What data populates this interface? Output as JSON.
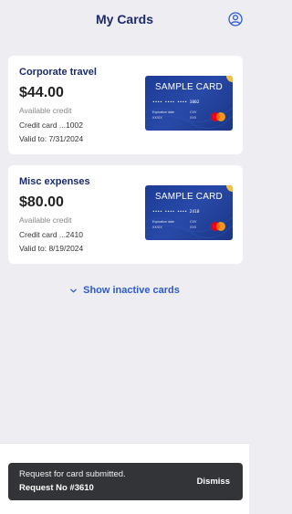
{
  "header": {
    "title": "My Cards",
    "profile_icon": "account-circle-icon"
  },
  "cards": [
    {
      "name": "Corporate travel",
      "amount": "$44.00",
      "available_label": "Available credit",
      "card_number": "Credit card ...1002",
      "valid_to": "Valid to: 7/31/2024",
      "image": {
        "label": "SAMPLE CARD",
        "masked_number": "•••• •••• •••• 1002",
        "expiration_label": "Expiration date",
        "expiration_value": "XX/XX",
        "cvv_label": "CVV",
        "cvv_value": "XXX"
      }
    },
    {
      "name": "Misc expenses",
      "amount": "$80.00",
      "available_label": "Available credit",
      "card_number": "Credit card ...2410",
      "valid_to": "Valid to: 8/19/2024",
      "image": {
        "label": "SAMPLE CARD",
        "masked_number": "•••• •••• •••• 2410",
        "expiration_label": "Expiration date",
        "expiration_value": "XX/XX",
        "cvv_label": "CVV",
        "cvv_value": "XXX"
      }
    }
  ],
  "show_inactive": {
    "label": "Show inactive cards",
    "icon": "chevron-down-icon"
  },
  "toast": {
    "message": "Request for card submitted.",
    "request_no": "Request No #3610",
    "dismiss_label": "Dismiss"
  },
  "colors": {
    "background": "#eeedf2",
    "title": "#1c2b6b",
    "link": "#2d5bd0",
    "card_blue": "#1d3c96",
    "toast_bg": "#333437"
  }
}
